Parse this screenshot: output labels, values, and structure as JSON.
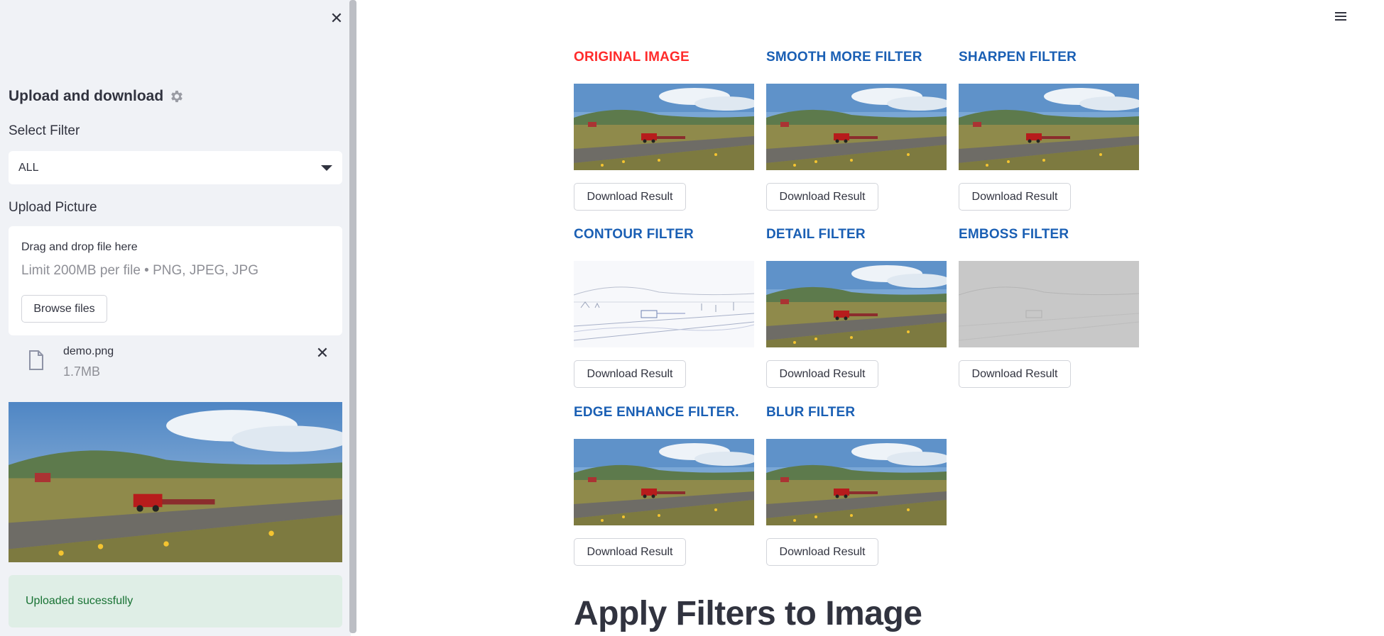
{
  "sidebar": {
    "title": "Upload and download",
    "select_label": "Select Filter",
    "select_value": "ALL",
    "upload_label": "Upload Picture",
    "dropzone_text": "Drag and drop file here",
    "dropzone_limit": "Limit 200MB per file • PNG, JPEG, JPG",
    "browse_label": "Browse files",
    "file_name": "demo.png",
    "file_size": "1.7MB",
    "success_message": "Uploaded sucessfully"
  },
  "filters": [
    {
      "title": "ORIGINAL IMAGE",
      "variant": "normal",
      "button": "Download Result",
      "highlight": true
    },
    {
      "title": "SMOOTH MORE FILTER",
      "variant": "normal",
      "button": "Download Result"
    },
    {
      "title": "SHARPEN FILTER",
      "variant": "normal",
      "button": "Download Result"
    },
    {
      "title": "CONTOUR FILTER",
      "variant": "contour",
      "button": "Download Result"
    },
    {
      "title": "DETAIL FILTER",
      "variant": "normal",
      "button": "Download Result"
    },
    {
      "title": "EMBOSS FILTER",
      "variant": "emboss",
      "button": "Download Result"
    },
    {
      "title": "EDGE ENHANCE FILTER.",
      "variant": "normal",
      "button": "Download Result"
    },
    {
      "title": "BLUR FILTER",
      "variant": "normal",
      "button": "Download Result"
    }
  ],
  "main": {
    "heading": "Apply Filters to Image"
  },
  "colors": {
    "title_blue": "#1a5fb4",
    "title_red": "#ff2b2b",
    "success_bg": "#dfeee6",
    "success_text": "#177233"
  }
}
